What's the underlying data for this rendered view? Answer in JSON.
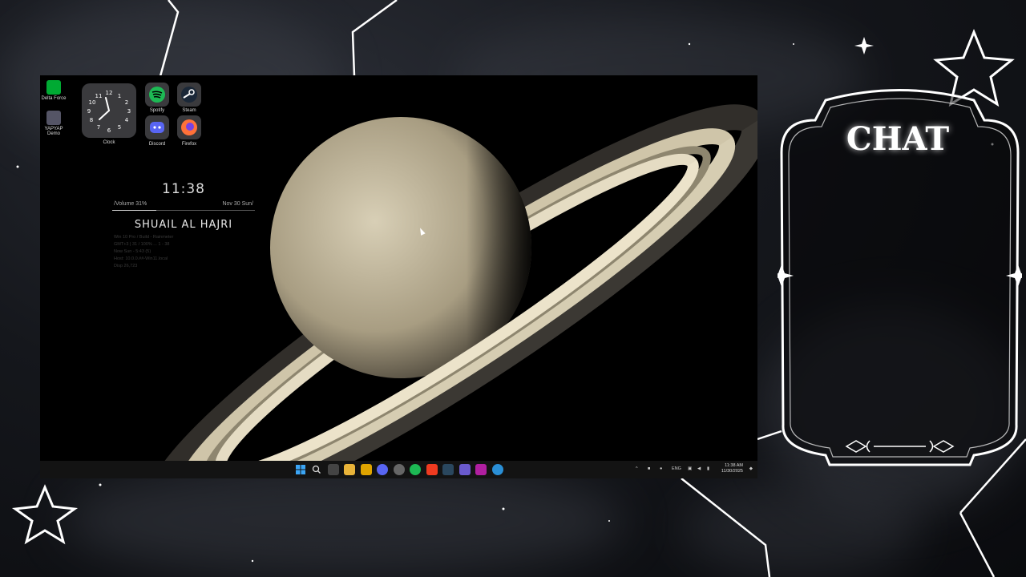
{
  "desktop": {
    "icons": [
      {
        "label": "Delta Force"
      },
      {
        "label": "YAPYAP Demo"
      }
    ],
    "clock_label": "Clock",
    "clock_numbers": [
      "12",
      "1",
      "2",
      "3",
      "4",
      "5",
      "6",
      "7",
      "8",
      "9",
      "10",
      "11"
    ],
    "apps": [
      {
        "label": "Spotify",
        "icon": "spotify-icon",
        "color": "#1db954"
      },
      {
        "label": "Steam",
        "icon": "steam-icon",
        "color": "#1b2838"
      },
      {
        "label": "Discord",
        "icon": "discord-icon",
        "color": "#5865f2"
      },
      {
        "label": "Firefox",
        "icon": "firefox-icon",
        "color": "#ff7139"
      }
    ]
  },
  "widget": {
    "time": "11:38",
    "volume": "/Volume",
    "volume_pct": "31%",
    "volume_level": 0.31,
    "date": "Nov 30 Sun/",
    "name": "SHUAIL AL HAJRI",
    "info_lines": [
      "Win 10 Pro / Build - Rainmeter",
      "GMT+3 | 31 / 100% ... 1 - 38",
      "Now Sun - 5:43 (5)",
      "Host: 10.0.0.##-Win11.local",
      "Disp 26,723"
    ]
  },
  "taskbar": {
    "lang": "ENG",
    "time": "11:38 AM",
    "date": "11/30/2025"
  },
  "chat": {
    "title": "CHAT"
  },
  "colors": {
    "accent": "#ffffff",
    "planet": "#c9bfa4",
    "ring": "#e5dcc3"
  }
}
